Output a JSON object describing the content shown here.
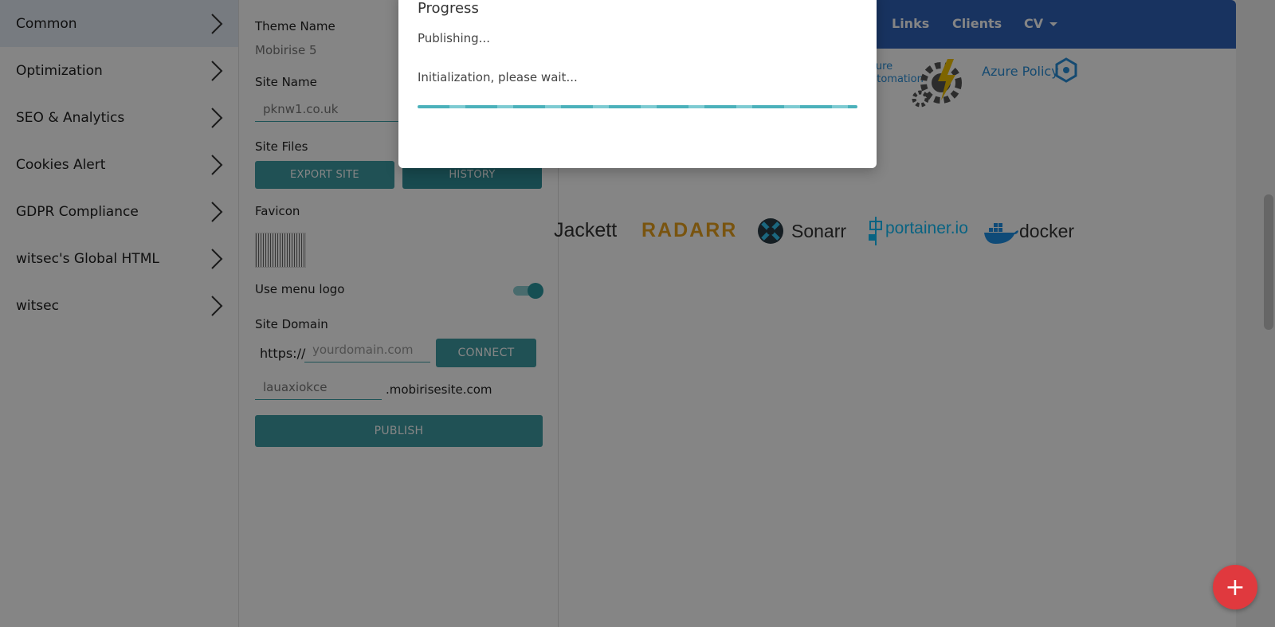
{
  "sidebar": {
    "items": [
      {
        "label": "Common"
      },
      {
        "label": "Optimization"
      },
      {
        "label": "SEO & Analytics"
      },
      {
        "label": "Cookies Alert"
      },
      {
        "label": "GDPR Compliance"
      },
      {
        "label": "witsec's Global HTML"
      },
      {
        "label": "witsec"
      }
    ]
  },
  "settings": {
    "theme_name_label": "Theme Name",
    "theme_name_value": "Mobirise 5",
    "site_name_label": "Site Name",
    "site_name_value": "pknw1.co.uk",
    "site_files_label": "Site Files",
    "export_label": "EXPORT SITE",
    "history_label": "HISTORY",
    "favicon_label": "Favicon",
    "menu_logo_label": "Use menu logo",
    "menu_logo_on": true,
    "site_domain_label": "Site Domain",
    "https_prefix": "https://",
    "domain_placeholder": "yourdomain.com",
    "connect_label": "CONNECT",
    "subdomain_value": "lauaxiokce",
    "subdomain_suffix": ".mobirisesite.com",
    "publish_label": "PUBLISH"
  },
  "preview": {
    "nav_links": [
      "Links",
      "Clients",
      "CV"
    ],
    "logos_row1": [
      "zure",
      "utomation",
      "Azure Policy"
    ],
    "logos_row2": [
      "Jackett",
      "RADARR",
      "Sonarr",
      "portainer.io",
      "docker"
    ]
  },
  "modal": {
    "title": "Progress",
    "status": "Publishing...",
    "message": "Initialization, please wait..."
  },
  "fab": {
    "label": "+"
  },
  "colors": {
    "accent": "#3f9ba3",
    "navbar": "#2f63b9",
    "fab": "#e0393e"
  }
}
